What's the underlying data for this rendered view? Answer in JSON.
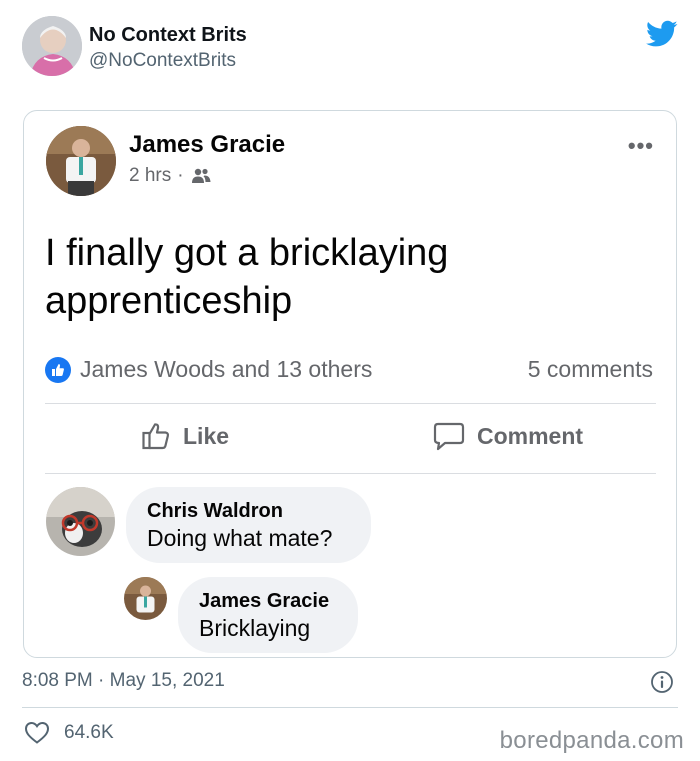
{
  "tweet": {
    "author_name": "No Context Brits",
    "author_handle": "@NoContextBrits",
    "timestamp": "8:08 PM · May 15, 2021",
    "like_count": "64.6K",
    "brand_color": "#1d9bf0"
  },
  "facebook_post": {
    "author_name": "James Gracie",
    "time_ago": "2 hrs",
    "meta_separator": "·",
    "audience_icon": "friends-icon",
    "text": "I finally got a bricklaying apprenticeship",
    "reactions_text": "James Woods and 13 others",
    "comments_count": "5 comments",
    "like_label": "Like",
    "comment_label": "Comment",
    "like_color": "#1877f2"
  },
  "comments": [
    {
      "author": "Chris Waldron",
      "text": "Doing what mate?"
    },
    {
      "author": "James Gracie",
      "text": "Bricklaying"
    }
  ],
  "watermark": "boredpanda.com"
}
